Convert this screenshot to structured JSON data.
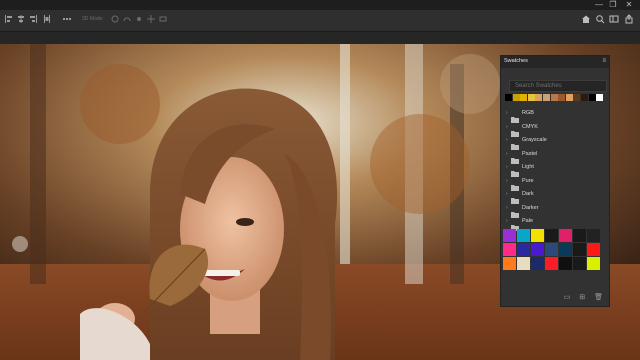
{
  "window_controls": [
    "—",
    "❐",
    "✕"
  ],
  "options_bar": {
    "label_3d": "3D Mode:",
    "left_icons": [
      "align-left-icon",
      "align-center-icon",
      "align-right-icon",
      "distribute-icon",
      "more-icon"
    ],
    "mode_icons": [
      "rotate-3d-icon",
      "roll-3d-icon",
      "drag-3d-icon",
      "slide-3d-icon",
      "scale-3d-icon"
    ],
    "right_icons": [
      "home-icon",
      "search-icon",
      "workspace-icon",
      "share-icon"
    ]
  },
  "swatches_panel": {
    "title": "Swatches",
    "menu_glyph": "≡",
    "search_placeholder": "Search Swatches",
    "recent_colors": [
      "#000000",
      "#c9a200",
      "#e0b000",
      "#e8c23a",
      "#d8a25a",
      "#caa17a",
      "#b47a4a",
      "#9a5a30",
      "#e0a060",
      "#5a3a20",
      "#2a1a10",
      "#000000",
      "#ffffff"
    ],
    "groups": [
      {
        "name": "RGB"
      },
      {
        "name": "CMYK"
      },
      {
        "name": "Grayscale"
      },
      {
        "name": "Pastel"
      },
      {
        "name": "Light"
      },
      {
        "name": "Pure"
      },
      {
        "name": "Dark"
      },
      {
        "name": "Darker"
      },
      {
        "name": "Pale"
      }
    ],
    "grid_rows": [
      [
        "#9b2fd6",
        "#0aa6c9",
        "#f2e000",
        "#1a1a1a",
        "#e0206a",
        "#1a1a1a",
        "#222222"
      ],
      [
        "#ff2a8a",
        "#2a2aa0",
        "#4a1ad0",
        "#2a4a7a",
        "#0a3a5a",
        "#1a1a1a",
        "#ff1a1a"
      ],
      [
        "#ff7a1a",
        "#e8dcc0",
        "#1a2a6a",
        "#ff1a2a",
        "#101010",
        "#1a1a1a",
        "#d8f000"
      ]
    ],
    "bottom_icons": [
      "folder-icon",
      "new-swatch-icon",
      "delete-icon"
    ]
  }
}
